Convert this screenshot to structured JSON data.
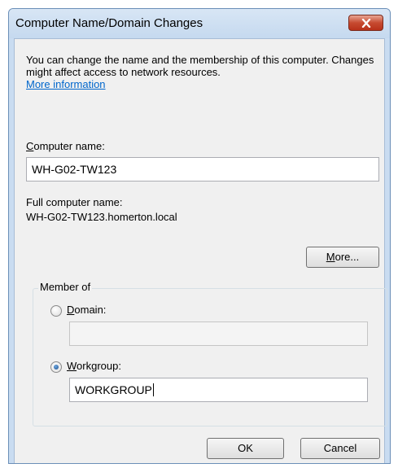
{
  "window": {
    "title": "Computer Name/Domain Changes"
  },
  "intro": {
    "text": "You can change the name and the membership of this computer. Changes might affect access to network resources.",
    "link": "More information"
  },
  "computer_name": {
    "label_first": "C",
    "label_rest": "omputer name:",
    "value": "WH-G02-TW123"
  },
  "full_name": {
    "label": "Full computer name:",
    "value": "WH-G02-TW123.homerton.local"
  },
  "more_button": {
    "underlined": "M",
    "rest": "ore..."
  },
  "member_of": {
    "label": "Member of",
    "domain": {
      "underlined": "D",
      "rest": "omain:",
      "checked": false,
      "value": ""
    },
    "workgroup": {
      "underlined": "W",
      "rest": "orkgroup:",
      "checked": true,
      "value": "WORKGROUP"
    }
  },
  "buttons": {
    "ok": "OK",
    "cancel": "Cancel"
  },
  "colors": {
    "accent_link": "#0066cc",
    "close_button": "#c74a30"
  },
  "icons": {
    "close": "close-x-icon",
    "radio": "radio-icon"
  }
}
